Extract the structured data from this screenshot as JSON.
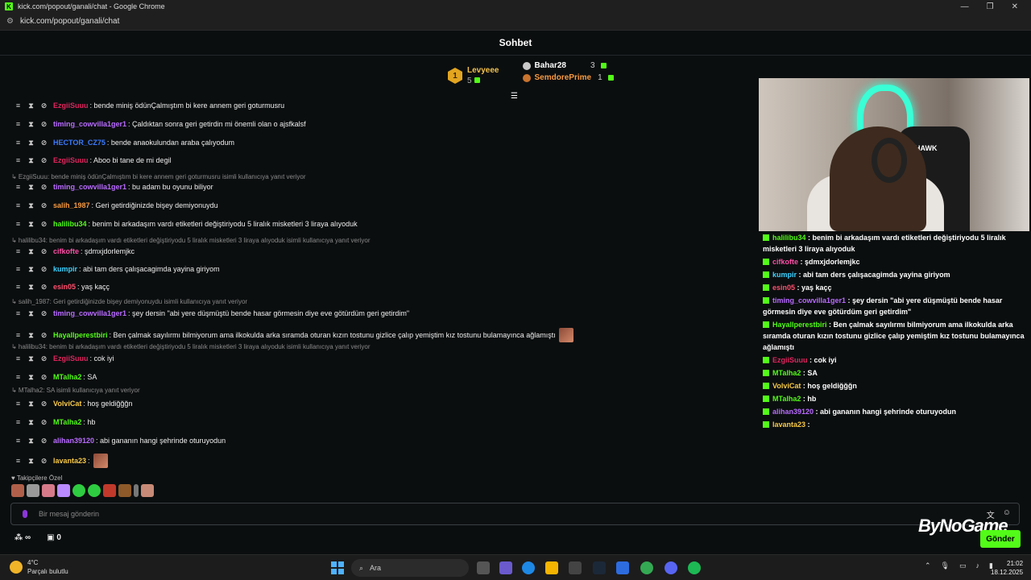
{
  "window": {
    "title": "kick.com/popout/ganali/chat - Google Chrome",
    "url": "kick.com/popout/ganali/chat",
    "favicon_letter": "K"
  },
  "chat": {
    "header": "Sohbet",
    "leaderboard": {
      "first": {
        "rank": "1",
        "name": "Levyeee",
        "count": "5"
      },
      "second": {
        "name": "Bahar28",
        "count": "3"
      },
      "third": {
        "name": "SemdorePrime",
        "count": "1"
      }
    },
    "messages": [
      {
        "user": "EzgiiSuuu",
        "color": "#e0245e",
        "text": ": bende miniş ödünÇalmıştım bi kere annem geri goturmusru"
      },
      {
        "user": "timing_cowvilla1ger1",
        "color": "#b86bff",
        "text": ": Çaldıktan sonra geri getirdin mi önemli olan o ajsfkalsf"
      },
      {
        "user": "HECTOR_CZ75",
        "color": "#3b7bff",
        "text": ": bende anaokulundan araba çalıyodum"
      },
      {
        "user": "EzgiiSuuu",
        "color": "#e0245e",
        "text": ": Aboo bi tane de mi degil"
      },
      {
        "reply": "EzgiiSuuu: bende miniş ödünÇalmıştım bi kere annem geri goturmusru isimli kullanıcıya yanıt veriyor"
      },
      {
        "user": "timing_cowvilla1ger1",
        "color": "#b86bff",
        "text": ": bu adam bu oyunu biliyor"
      },
      {
        "user": "salih_1987",
        "color": "#f79a41",
        "text": ": Geri getirdiğinizde bişey demiyonuydu"
      },
      {
        "user": "halilibu34",
        "color": "#53fc18",
        "text": ": benim bi arkadaşım vardı etiketleri değiştiriyodu 5 liralık misketleri 3 liraya alıyoduk"
      },
      {
        "reply": "halilibu34: benim bi arkadaşım vardı etiketleri değiştiriyodu 5 liralık misketleri 3 liraya alıyoduk isimli kullanıcıya yanıt veriyor"
      },
      {
        "user": "cifkofte",
        "color": "#ff4fa8",
        "text": ": şdmxjdorlemjkc"
      },
      {
        "user": "kumpir",
        "color": "#3cd2ff",
        "text": ": abi tam ders çalışacagimda yayina giriyom"
      },
      {
        "user": "esin05",
        "color": "#ff4f6d",
        "text": ": yaş kaçç"
      },
      {
        "reply": "salih_1987: Geri getirdiğinizde bişey demiyonuydu isimli kullanıcıya yanıt veriyor"
      },
      {
        "user": "timing_cowvilla1ger1",
        "color": "#b86bff",
        "text": ": şey dersin \"abi yere düşmüştü bende hasar görmesin diye eve götürdüm geri getirdim\""
      },
      {
        "user": "Hayallperestbiri",
        "color": "#53fc18",
        "text": ": Ben çalmak sayılırmı bilmiyorum ama ilkokulda arka sıramda oturan kızın tostunu gizlice çalıp yemiştim kız tostunu bulamayınca ağlamıştı"
      },
      {
        "reply": "halilibu34: benim bi arkadaşım vardı etiketleri değiştiriyodu 5 liralık misketleri 3 liraya alıyoduk isimli kullanıcıya yanıt veriyor"
      },
      {
        "user": "EzgiiSuuu",
        "color": "#e0245e",
        "text": ": cok iyi"
      },
      {
        "user": "MTalha2",
        "color": "#53fc18",
        "text": ": SA"
      },
      {
        "reply": "MTalha2: SA isimli kullanıcıya yanıt veriyor"
      },
      {
        "user": "VolviCat",
        "color": "#f7c948",
        "text": ": hoş geldiğğğn"
      },
      {
        "user": "MTalha2",
        "color": "#53fc18",
        "text": ": hb"
      },
      {
        "user": "alihan39120",
        "color": "#b86bff",
        "text": ": abi gananın hangi şehrinde oturuyodun"
      },
      {
        "user": "lavanta23",
        "color": "#f7c948",
        "text": ":"
      }
    ],
    "followers_label": "Takipçilere Özel",
    "input_placeholder": "Bir mesaj gönderin",
    "send_label": "Gönder",
    "bottom_count": "0",
    "watermark": "ByNoGame"
  },
  "video": {
    "chair_brand": "HAWK"
  },
  "overlay_messages": [
    {
      "user": "halilibu34",
      "color": "#53fc18",
      "text": " : benim bi arkadaşım vardı etiketleri değiştiriyodu 5 liralık misketleri 3 liraya alıyoduk"
    },
    {
      "user": "cifkofte",
      "color": "#ff4fa8",
      "text": " : şdmxjdorlemjkc"
    },
    {
      "user": "kumpir",
      "color": "#3cd2ff",
      "text": " : abi tam ders çalışacagimda yayina giriyom"
    },
    {
      "user": "esin05",
      "color": "#ff4f6d",
      "text": " : yaş kaçç"
    },
    {
      "user": "timing_cowvilla1ger1",
      "color": "#b86bff",
      "text": " : şey dersin \"abi yere düşmüştü bende hasar görmesin diye eve götürdüm geri getirdim\""
    },
    {
      "user": "Hayallperestbiri",
      "color": "#53fc18",
      "text": " : Ben çalmak sayılırmı bilmiyorum ama ilkokulda arka sıramda oturan kızın tostunu gizlice çalıp yemiştim kız tostunu bulamayınca ağlamıştı"
    },
    {
      "user": "EzgiiSuuu",
      "color": "#e0245e",
      "text": " : cok iyi"
    },
    {
      "user": "MTalha2",
      "color": "#53fc18",
      "text": " : SA"
    },
    {
      "user": "VolviCat",
      "color": "#f7c948",
      "text": " : hoş geldiğğğn"
    },
    {
      "user": "MTalha2",
      "color": "#53fc18",
      "text": " : hb"
    },
    {
      "user": "alihan39120",
      "color": "#b86bff",
      "text": " : abi gananın hangi şehrinde oturuyodun"
    },
    {
      "user": "lavanta23",
      "color": "#f7c948",
      "text": " :"
    }
  ],
  "taskbar": {
    "temperature": "4°C",
    "weather": "Parçalı bulutlu",
    "search": "Ara",
    "time": "21:02",
    "date": "18.12.2025"
  },
  "colors": {
    "accent": "#53fc18",
    "background": "#0b0e0f"
  }
}
